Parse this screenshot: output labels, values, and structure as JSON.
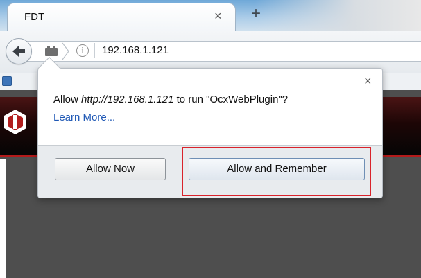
{
  "browser": {
    "tab_title": "FDT",
    "tab_close_glyph": "×",
    "new_tab_glyph": "+",
    "url": "192.168.1.121",
    "info_glyph": "i"
  },
  "dialog": {
    "message_prefix": "Allow ",
    "message_url": "http://192.168.1.121",
    "message_suffix": " to run \"OcxWebPlugin\"?",
    "learn_more": "Learn More...",
    "close_glyph": "×",
    "allow_now": {
      "before": "Allow ",
      "accel": "N",
      "after": "ow"
    },
    "allow_remember": {
      "before": "Allow and ",
      "accel": "R",
      "after": "emember"
    }
  },
  "colors": {
    "link": "#1f58b5",
    "highlight_border": "#d9232b",
    "page_bg": "#4e4e4e",
    "header_accent": "#b31a1a"
  },
  "icons": [
    "back-arrow-icon",
    "plugin-icon",
    "info-icon",
    "bookmark-icon",
    "site-logo-icon",
    "close-icon"
  ]
}
